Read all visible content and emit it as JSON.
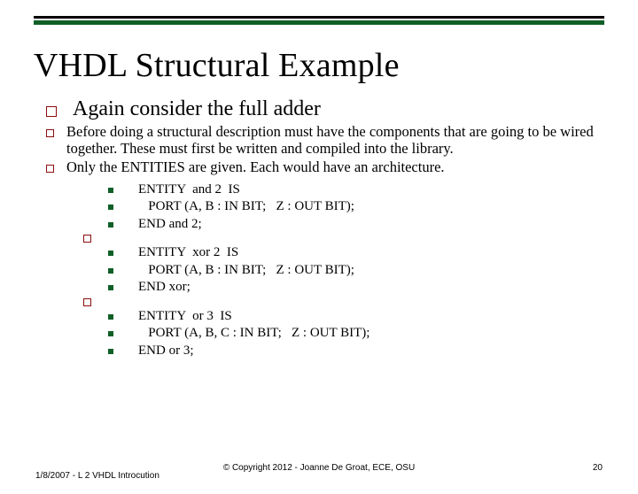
{
  "title": "VHDL Structural Example",
  "bullets_o": [
    "Again consider the full adder",
    "Before doing a structural description must have the components that are going to be wired together.  These must first be written and compiled into the library.",
    "Only the ENTITIES are given.  Each would have an architecture."
  ],
  "code": {
    "and2": [
      "ENTITY  and 2  IS",
      "   PORT (A, B : IN BIT;   Z : OUT BIT);",
      "END and 2;"
    ],
    "xor2": [
      "ENTITY  xor 2  IS",
      "   PORT (A, B : IN BIT;   Z : OUT BIT);",
      "END xor;"
    ],
    "or3": [
      "ENTITY  or 3  IS",
      "   PORT (A, B, C : IN BIT;   Z : OUT BIT);",
      "END or 3;"
    ]
  },
  "footer": {
    "left": "1/8/2007 - L 2 VHDL Introcution",
    "center": "© Copyright 2012 - Joanne De Groat, ECE, OSU",
    "right": "20"
  }
}
